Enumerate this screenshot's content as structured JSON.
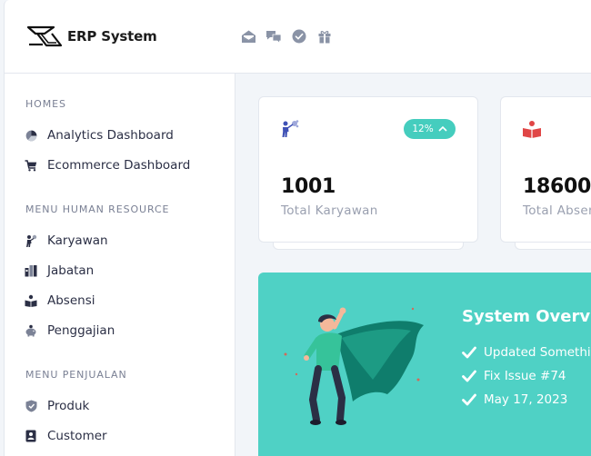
{
  "app": {
    "brand": "ERP System"
  },
  "header": {
    "icons": [
      "mail-open-icon",
      "chat-icon",
      "check-circle-icon",
      "gift-icon"
    ]
  },
  "sidebar": {
    "sections": [
      {
        "heading": "HOMES",
        "items": [
          {
            "label": "Analytics Dashboard",
            "icon": "pie-chart-icon"
          },
          {
            "label": "Ecommerce Dashboard",
            "icon": "cart-icon"
          }
        ]
      },
      {
        "heading": "MENU HUMAN RESOURCE",
        "items": [
          {
            "label": "Karyawan",
            "icon": "employee-icon"
          },
          {
            "label": "Jabatan",
            "icon": "position-icon"
          },
          {
            "label": "Absensi",
            "icon": "attendance-book-icon"
          },
          {
            "label": "Penggajian",
            "icon": "piggy-bank-icon"
          }
        ]
      },
      {
        "heading": "MENU PENJUALAN",
        "items": [
          {
            "label": "Produk",
            "icon": "product-shield-icon"
          },
          {
            "label": "Customer",
            "icon": "customer-badge-icon"
          }
        ]
      }
    ]
  },
  "cards": [
    {
      "value": "1001",
      "label": "Total Karyawan",
      "badge": "12%",
      "icon": "employee-network-icon",
      "icon_color": "#3f51b5"
    },
    {
      "value": "18600",
      "label": "Total Absensi",
      "icon": "red-book-icon",
      "icon_color": "#e04646"
    }
  ],
  "overview": {
    "title": "System Overview",
    "items": [
      "Updated Something",
      "Fix Issue #74",
      "May 17, 2023"
    ],
    "bg_color": "#4fd1c5"
  }
}
